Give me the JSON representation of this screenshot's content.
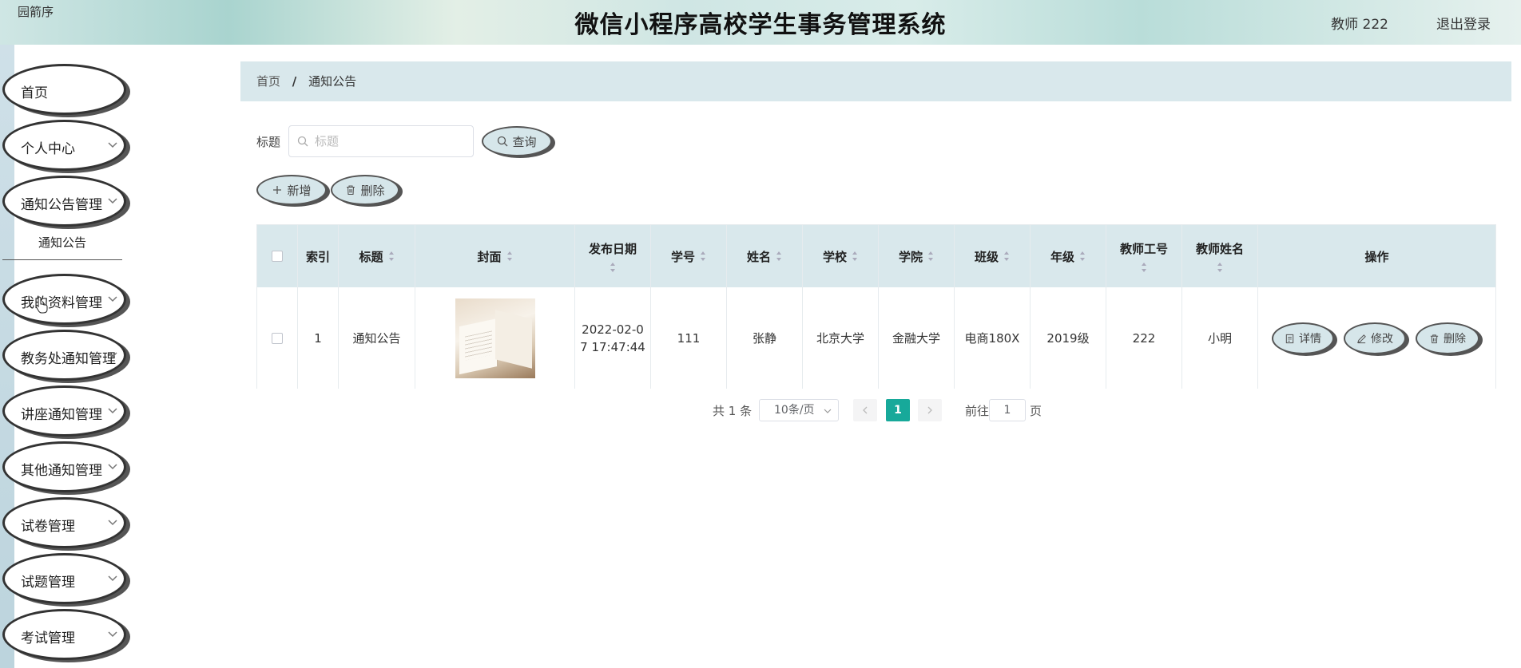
{
  "header": {
    "logo_text": "园箭序",
    "title": "微信小程序高校学生事务管理系统",
    "user": "教师 222",
    "logout": "退出登录"
  },
  "sidebar": {
    "items": [
      {
        "label": "首页",
        "has_chevron": false
      },
      {
        "label": "个人中心",
        "has_chevron": true
      },
      {
        "label": "通知公告管理",
        "has_chevron": true
      },
      {
        "label": "我的资料管理",
        "has_chevron": true
      },
      {
        "label": "教务处通知管理",
        "has_chevron": true
      },
      {
        "label": "讲座通知管理",
        "has_chevron": true
      },
      {
        "label": "其他通知管理",
        "has_chevron": true
      },
      {
        "label": "试卷管理",
        "has_chevron": true
      },
      {
        "label": "试题管理",
        "has_chevron": true
      },
      {
        "label": "考试管理",
        "has_chevron": true
      }
    ],
    "submenu_label": "通知公告"
  },
  "breadcrumb": {
    "home": "首页",
    "separator": "/",
    "current": "通知公告"
  },
  "search": {
    "label": "标题",
    "placeholder": "标题",
    "value": "",
    "query_button": "查询"
  },
  "toolbar": {
    "add_label": "新增",
    "delete_label": "删除"
  },
  "table": {
    "headers": {
      "index": "索引",
      "title": "标题",
      "cover": "封面",
      "date": "发布日期",
      "student_no": "学号",
      "name": "姓名",
      "school": "学校",
      "college": "学院",
      "class": "班级",
      "grade": "年级",
      "teacher_no": "教师工号",
      "teacher_name": "教师姓名",
      "actions": "操作"
    },
    "rows": [
      {
        "index": "1",
        "title": "通知公告",
        "date_line1": "2022-02-0",
        "date_line2": "7 17:47:44",
        "student_no": "111",
        "name": "张静",
        "school": "北京大学",
        "college": "金融大学",
        "class": "电商180X",
        "grade": "2019级",
        "teacher_no": "222",
        "teacher_name": "小明",
        "actions": {
          "detail": "详情",
          "edit": "修改",
          "delete": "删除"
        }
      }
    ]
  },
  "pagination": {
    "total": "共 1 条",
    "page_size": "10条/页",
    "current_page": "1",
    "goto_label": "前往",
    "goto_value": "1",
    "page_unit": "页"
  },
  "colors": {
    "accent": "#17a99a",
    "header_bg": "#d9e8ec",
    "button_bg": "#d6e6ea"
  }
}
